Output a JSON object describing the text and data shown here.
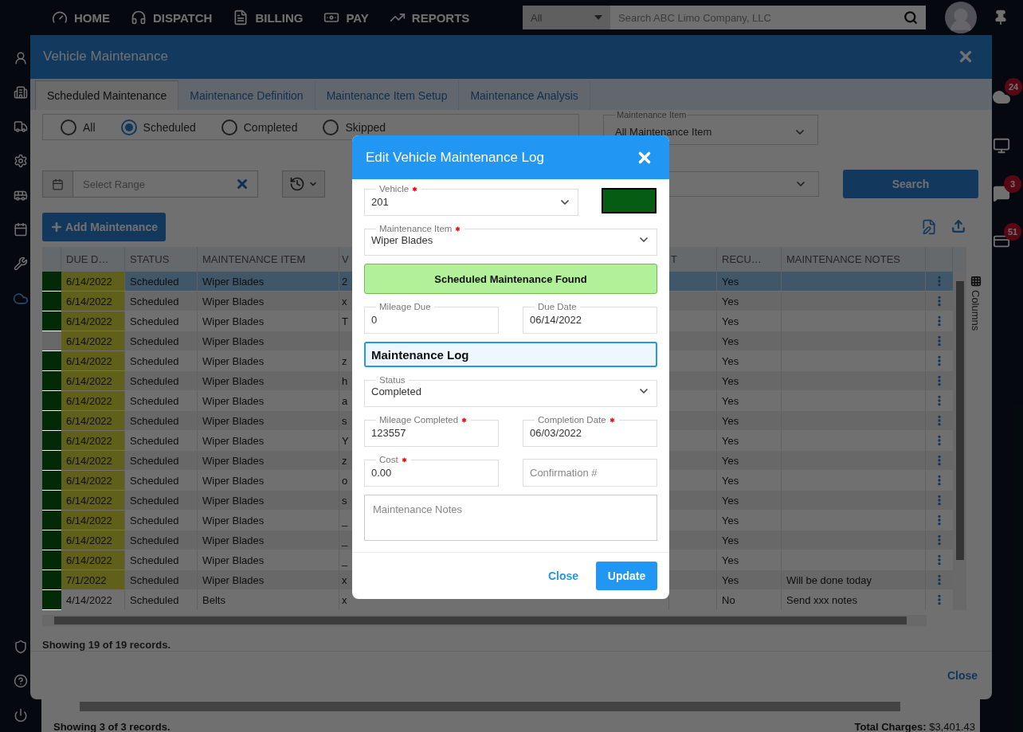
{
  "top_nav": {
    "items": [
      {
        "label": "HOME"
      },
      {
        "label": "DISPATCH"
      },
      {
        "label": "BILLING"
      },
      {
        "label": "PAY"
      },
      {
        "label": "REPORTS"
      }
    ],
    "search": {
      "scope": "All",
      "placeholder": "Search ABC Limo Company, LLC"
    }
  },
  "right_badges": [
    "24",
    "3",
    "51"
  ],
  "background_page": {
    "record_count": "Showing 3 of 3 records.",
    "total_label": "Total Charges:",
    "total_value": "$3,401.43"
  },
  "dialog": {
    "title": "Vehicle Maintenance",
    "tabs": [
      {
        "label": "Scheduled Maintenance",
        "selected": true
      },
      {
        "label": "Maintenance Definition",
        "selected": false
      },
      {
        "label": "Maintenance Item Setup",
        "selected": false
      },
      {
        "label": "Maintenance Analysis",
        "selected": false
      }
    ],
    "status_filter": [
      {
        "label": "All",
        "selected": false
      },
      {
        "label": "Scheduled",
        "selected": true
      },
      {
        "label": "Completed",
        "selected": false
      },
      {
        "label": "Skipped",
        "selected": false
      }
    ],
    "date_range": {
      "placeholder": "Select Range"
    },
    "maintenance_item": {
      "label": "Maintenance Item",
      "value": "All Maintenance Item"
    },
    "search_button": "Search",
    "add_button": "Add Maintenance",
    "table": {
      "columns": [
        "DUE D…",
        "STATUS",
        "MAINTENANCE ITEM",
        "V",
        "T",
        "RECU…",
        "MAINTENANCE NOTES"
      ],
      "rows": [
        {
          "color": "#022a06",
          "due": "6/14/2022",
          "due_highlight": true,
          "status": "Scheduled",
          "item": "Wiper Blades",
          "vehicle": "2",
          "recurring": "Yes",
          "selected": true
        },
        {
          "color": "#022a06",
          "due": "6/14/2022",
          "due_highlight": true,
          "status": "Scheduled",
          "item": "Wiper Blades",
          "vehicle": "x",
          "recurring": "Yes",
          "selected": false
        },
        {
          "color": "#022a06",
          "due": "6/14/2022",
          "due_highlight": true,
          "status": "Scheduled",
          "item": "Wiper Blades",
          "vehicle": "T",
          "recurring": "Yes",
          "selected": false
        },
        {
          "due": "6/14/2022",
          "due_highlight": true,
          "status": "Scheduled",
          "item": "Wiper Blades",
          "recurring": "Yes",
          "selected": false
        },
        {
          "color": "#022a06",
          "due": "6/14/2022",
          "due_highlight": true,
          "status": "Scheduled",
          "item": "Wiper Blades",
          "vehicle": "z",
          "recurring": "Yes",
          "selected": false
        },
        {
          "color": "#022a06",
          "due": "6/14/2022",
          "due_highlight": true,
          "status": "Scheduled",
          "item": "Wiper Blades",
          "vehicle": "h",
          "recurring": "Yes",
          "selected": false
        },
        {
          "color": "#022a06",
          "due": "6/14/2022",
          "due_highlight": true,
          "status": "Scheduled",
          "item": "Wiper Blades",
          "vehicle": "a",
          "recurring": "Yes",
          "selected": false
        },
        {
          "color": "#022a06",
          "due": "6/14/2022",
          "due_highlight": true,
          "status": "Scheduled",
          "item": "Wiper Blades",
          "vehicle": "s",
          "recurring": "Yes",
          "selected": false
        },
        {
          "color": "#022a06",
          "due": "6/14/2022",
          "due_highlight": true,
          "status": "Scheduled",
          "item": "Wiper Blades",
          "vehicle": "Y",
          "recurring": "Yes",
          "selected": false
        },
        {
          "color": "#022a06",
          "due": "6/14/2022",
          "due_highlight": true,
          "status": "Scheduled",
          "item": "Wiper Blades",
          "vehicle": "z",
          "recurring": "Yes",
          "selected": false
        },
        {
          "color": "#022a06",
          "due": "6/14/2022",
          "due_highlight": true,
          "status": "Scheduled",
          "item": "Wiper Blades",
          "vehicle": "o",
          "recurring": "Yes",
          "selected": false
        },
        {
          "color": "#022a06",
          "due": "6/14/2022",
          "due_highlight": true,
          "status": "Scheduled",
          "item": "Wiper Blades",
          "vehicle": "s",
          "recurring": "Yes",
          "selected": false
        },
        {
          "color": "#022a06",
          "due": "6/14/2022",
          "due_highlight": true,
          "status": "Scheduled",
          "item": "Wiper Blades",
          "vehicle": "_",
          "recurring": "Yes",
          "selected": false
        },
        {
          "color": "#022a06",
          "due": "6/14/2022",
          "due_highlight": true,
          "status": "Scheduled",
          "item": "Wiper Blades",
          "vehicle": "_",
          "recurring": "Yes",
          "selected": false
        },
        {
          "color": "#022a06",
          "due": "6/14/2022",
          "due_highlight": true,
          "status": "Scheduled",
          "item": "Wiper Blades",
          "vehicle": "_",
          "recurring": "Yes",
          "selected": false
        },
        {
          "color": "#022a06",
          "due": "7/1/2022",
          "due_highlight": true,
          "status": "Scheduled",
          "item": "Wiper Blades",
          "vehicle": "x",
          "recurring": "Yes",
          "notes": "Will be done today",
          "selected": false
        },
        {
          "color": "#022a06",
          "due": "4/14/2022",
          "due_highlight": false,
          "status": "Scheduled",
          "item": "Belts",
          "vehicle": "x",
          "recurring": "No",
          "notes": "Send xxx notes",
          "selected": false
        }
      ]
    },
    "record_count": "Showing 19 of 19 records.",
    "close": "Close",
    "columns_tab": "Columns"
  },
  "edit_modal": {
    "title": "Edit Vehicle Maintenance Log",
    "vehicle": {
      "label": "Vehicle",
      "value": "201",
      "required": true
    },
    "maintenance_item": {
      "label": "Maintenance Item",
      "value": "Wiper Blades",
      "required": true
    },
    "alert": "Scheduled Maintenance Found",
    "mileage_due": {
      "label": "Mileage Due",
      "value": "0",
      "required": false
    },
    "due_date": {
      "label": "Due Date",
      "value": "06/14/2022",
      "required": false
    },
    "section_title": "Maintenance Log",
    "status": {
      "label": "Status",
      "value": "Completed",
      "required": false
    },
    "mileage_completed": {
      "label": "Mileage Completed",
      "value": "123557",
      "required": true
    },
    "completion_date": {
      "label": "Completion Date",
      "value": "06/03/2022",
      "required": true
    },
    "cost": {
      "label": "Cost",
      "value": "0.00",
      "required": true
    },
    "confirmation": {
      "placeholder": "Confirmation #"
    },
    "notes": {
      "placeholder": "Maintenance Notes"
    },
    "close_button": "Close",
    "update_button": "Update"
  }
}
